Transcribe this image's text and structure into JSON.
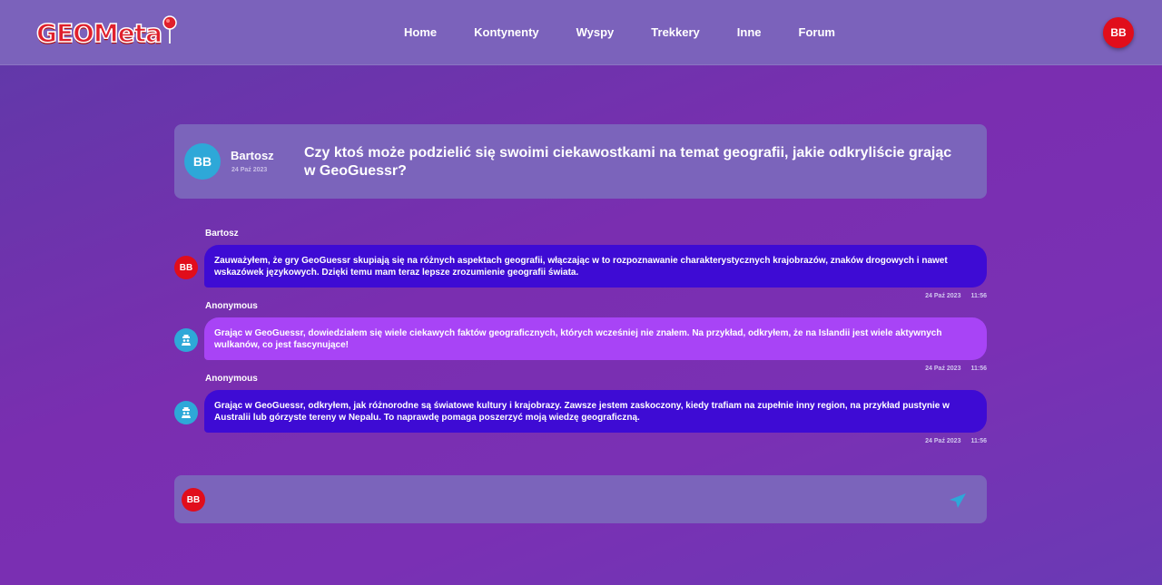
{
  "nav": {
    "logo_text": "GEOMeta",
    "links": [
      "Home",
      "Kontynenty",
      "Wyspy",
      "Trekkery",
      "Inne",
      "Forum"
    ],
    "user_initials": "BB"
  },
  "question": {
    "avatar_initials": "BB",
    "author": "Bartosz",
    "date": "24 Paź 2023",
    "text": "Czy ktoś może podzielić się swoimi ciekawostkami na temat geografii, jakie odkryliście grając w GeoGuessr?"
  },
  "comments": [
    {
      "author": "Bartosz",
      "avatar_initials": "BB",
      "text": "Zauważyłem, że gry GeoGuessr skupiają się na różnych aspektach geografii, włączając w to rozpoznawanie charakterystycznych krajobrazów, znaków drogowych i nawet wskazówek językowych. Dzięki temu mam teraz lepsze zrozumienie geografii świata.",
      "date": "24 Paź 2023",
      "time": "11:56"
    },
    {
      "author": "Anonymous",
      "avatar_icon": "anonymous-user-icon",
      "text": "Grając w GeoGuessr, dowiedziałem się wiele ciekawych faktów geograficznych, których wcześniej nie znałem. Na przykład, odkryłem, że na Islandii jest wiele aktywnych wulkanów, co jest fascynujące!",
      "date": "24 Paź 2023",
      "time": "11:56"
    },
    {
      "author": "Anonymous",
      "avatar_icon": "anonymous-user-icon",
      "text": "Grając w GeoGuessr, odkryłem, jak różnorodne są światowe kultury i krajobrazy. Zawsze jestem zaskoczony, kiedy trafiam na zupełnie inny region, na przykład pustynie w Australii lub górzyste tereny w Nepalu. To naprawdę pomaga poszerzyć moją wiedzę geograficzną.",
      "date": "24 Paź 2023",
      "time": "11:56"
    }
  ],
  "composer": {
    "avatar_initials": "BB",
    "placeholder": "",
    "send_icon": "send-icon"
  },
  "colors": {
    "navbar": "#7b62bb",
    "card": "#7b64bb",
    "bubble_own": "#3e0bd4",
    "bubble_other": "#a844f6",
    "avatar_red": "#e10d1b",
    "avatar_blue": "#2ea8d8"
  }
}
